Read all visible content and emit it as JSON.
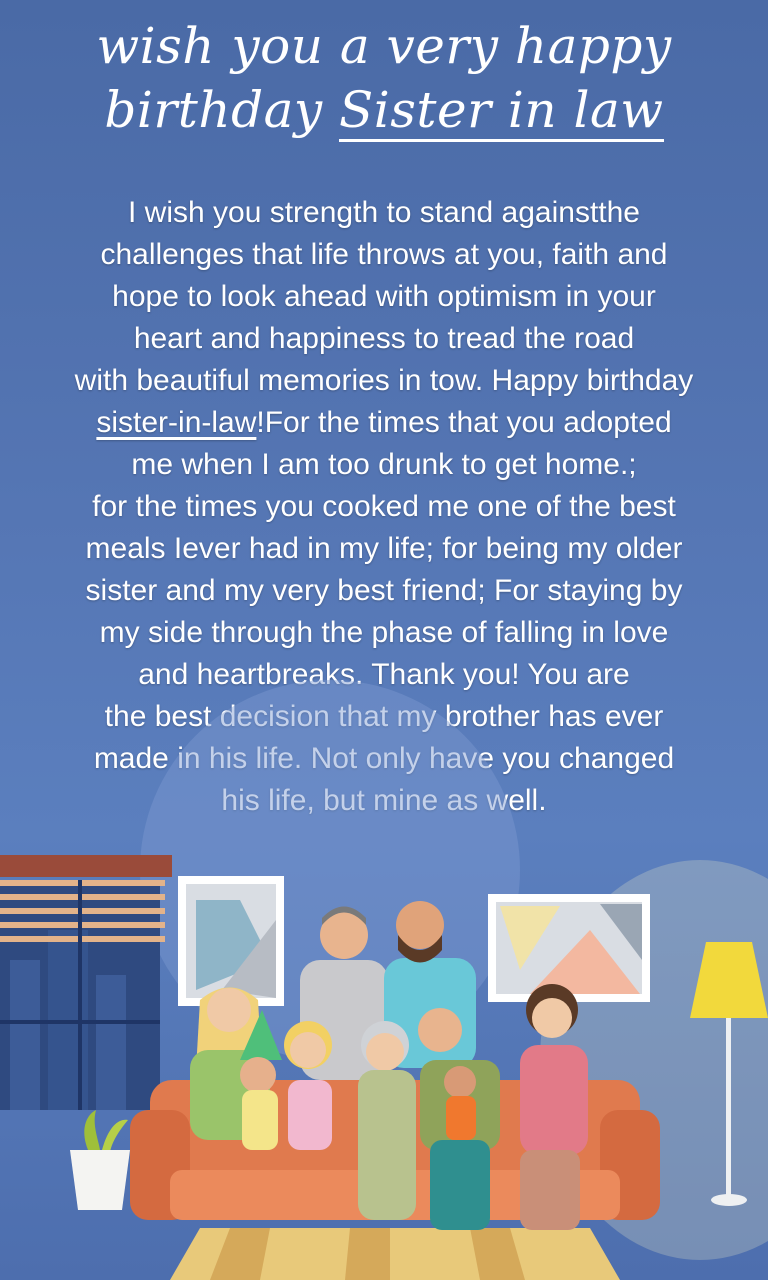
{
  "title": {
    "line1": "wish you a very happy",
    "line2_prefix": "birthday ",
    "line2_highlight": "Sister in law"
  },
  "message": {
    "l1": "I wish you strength to stand againstthe",
    "l2": "challenges that life throws at you, faith and",
    "l3": "hope to look ahead with optimism in your",
    "l4": "heart and happiness to tread the road",
    "l5": "with beautiful memories in tow. Happy birthday",
    "l6_link": "sister-in-law",
    "l6_rest": "!For the times that you adopted",
    "l7": "me when I am too drunk to get home.;",
    "l8": "for the times you cooked me one of the best",
    "l9": "meals Iever had in my life; for being my older",
    "l10": "sister and my very best friend; For staying by",
    "l11": "my side through the phase of falling in love",
    "l12": "and heartbreaks. Thank you! You are",
    "l13": "the best decision that my brother has ever",
    "l14": "made in his life. Not only have you changed",
    "l15": "his life, but mine as well."
  },
  "colors": {
    "background": "#5576b4",
    "text": "#ffffff",
    "sofa": "#e07a4e",
    "lamp_shade": "#f2d93c"
  },
  "illustration": {
    "subject": "family-on-sofa-illustration",
    "icons": [
      "window-blinds-icon",
      "wall-picture-icon",
      "floor-lamp-icon",
      "potted-plant-icon",
      "sofa-icon"
    ]
  }
}
